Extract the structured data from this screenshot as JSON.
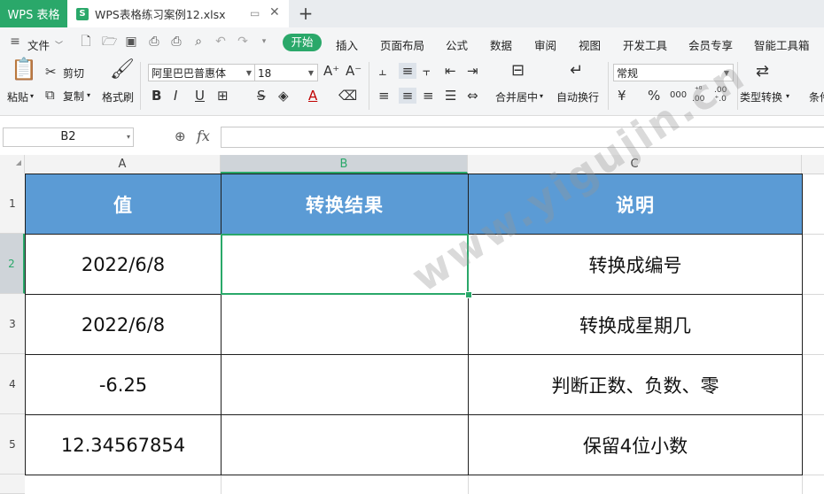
{
  "titlebar": {
    "app_name": "WPS 表格",
    "doc_tab": "WPS表格练习案例12.xlsx",
    "new_tab": "+"
  },
  "menu": {
    "file": "文件",
    "tabs": [
      "开始",
      "插入",
      "页面布局",
      "公式",
      "数据",
      "审阅",
      "视图",
      "开发工具",
      "会员专享",
      "智能工具箱"
    ]
  },
  "ribbon": {
    "paste": "粘贴",
    "cut": "剪切",
    "copy": "复制",
    "format_painter": "格式刷",
    "font_name": "阿里巴巴普惠体",
    "font_size": "18",
    "merge_center": "合并居中",
    "wrap_text": "自动换行",
    "number_format": "常规",
    "type_convert": "类型转换",
    "conditional": "条件"
  },
  "formula_bar": {
    "name_box": "B2",
    "fx": "fx",
    "value": ""
  },
  "sheet": {
    "columns": [
      "A",
      "B",
      "C"
    ],
    "rows": [
      "1",
      "2",
      "3",
      "4",
      "5"
    ],
    "header": [
      "值",
      "转换结果",
      "说明"
    ],
    "data": [
      [
        "2022/6/8",
        "",
        "转换成编号"
      ],
      [
        "2022/6/8",
        "",
        "转换成星期几"
      ],
      [
        "-6.25",
        "",
        "判断正数、负数、零"
      ],
      [
        "12.34567854",
        "",
        "保留4位小数"
      ]
    ],
    "selected_cell": "B2"
  },
  "watermark": "www.yigujin.cn",
  "colors": {
    "accent": "#2aa86a",
    "header_fill": "#5b9bd5",
    "selection": "#2aa86a"
  }
}
